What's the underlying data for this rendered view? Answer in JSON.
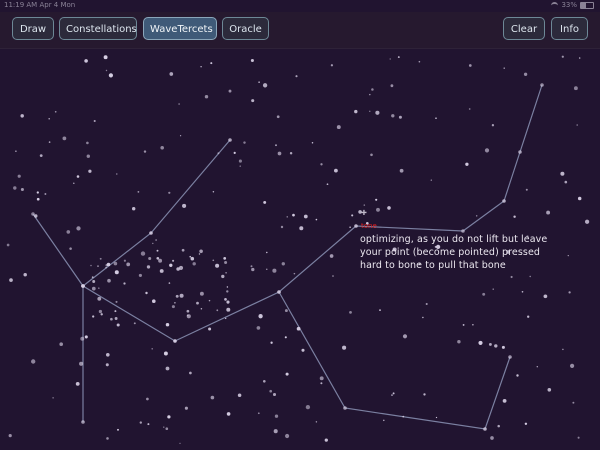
{
  "status_bar": {
    "time": "11:19 AM",
    "date": "Apr 4 Mon",
    "battery": "33%"
  },
  "toolbar": {
    "draw": "Draw",
    "constellations": "Constellations",
    "wavetercets": "WaveTercets",
    "oracle": "Oracle",
    "clear": "Clear",
    "info": "Info"
  },
  "canvas": {
    "red_label": "tone",
    "note_text": "optimizing, as you do not lift but leave your point (become pointed) pressed hard to bone to pull that bone"
  },
  "colors": {
    "background": "#211430",
    "toolbar": "#26192f",
    "active_button": "#3f5a78",
    "star": "#d7cfe4",
    "line": "#8b93b5",
    "red": "#e01e1e"
  }
}
